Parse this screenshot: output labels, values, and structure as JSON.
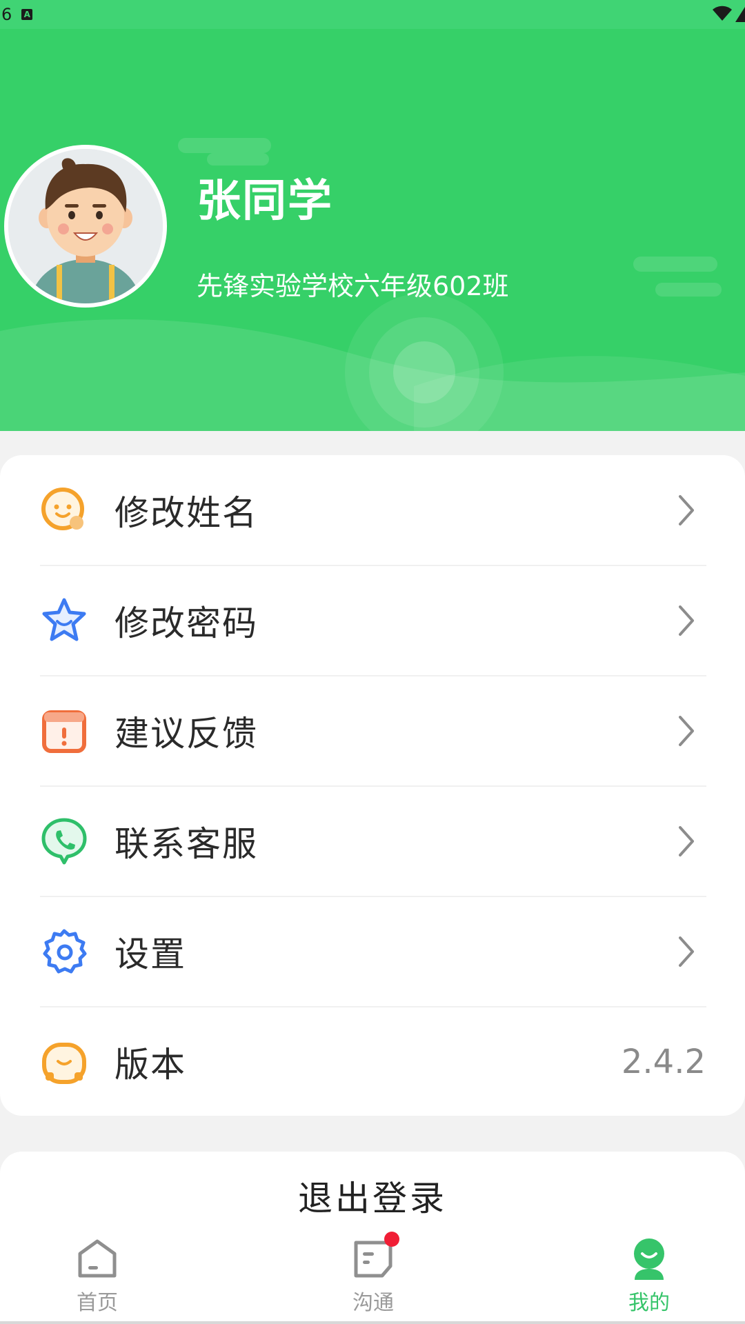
{
  "status_bar": {
    "left_text": "6",
    "a_badge": "A"
  },
  "profile": {
    "name": "张同学",
    "class": "先锋实验学校六年级602班"
  },
  "menu": {
    "items": [
      {
        "label": "修改姓名",
        "icon": "smile-bubble-icon"
      },
      {
        "label": "修改密码",
        "icon": "star-smile-icon"
      },
      {
        "label": "建议反馈",
        "icon": "feedback-box-icon"
      },
      {
        "label": "联系客服",
        "icon": "phone-bubble-icon"
      },
      {
        "label": "设置",
        "icon": "gear-icon"
      },
      {
        "label": "版本",
        "icon": "smile-clock-icon",
        "value": "2.4.2"
      }
    ]
  },
  "logout": {
    "label": "退出登录"
  },
  "bottom_nav": {
    "items": [
      {
        "label": "首页",
        "icon": "home-icon",
        "active": false
      },
      {
        "label": "沟通",
        "icon": "chat-icon",
        "active": false,
        "badge": true
      },
      {
        "label": "我的",
        "icon": "profile-icon",
        "active": true
      }
    ]
  },
  "colors": {
    "header_green": "#36d068",
    "accent_green": "#36c46a",
    "orange": "#f5a22b",
    "blue": "#3d7bf2",
    "red_orange": "#f06e3c",
    "badge_red": "#f01e35"
  }
}
